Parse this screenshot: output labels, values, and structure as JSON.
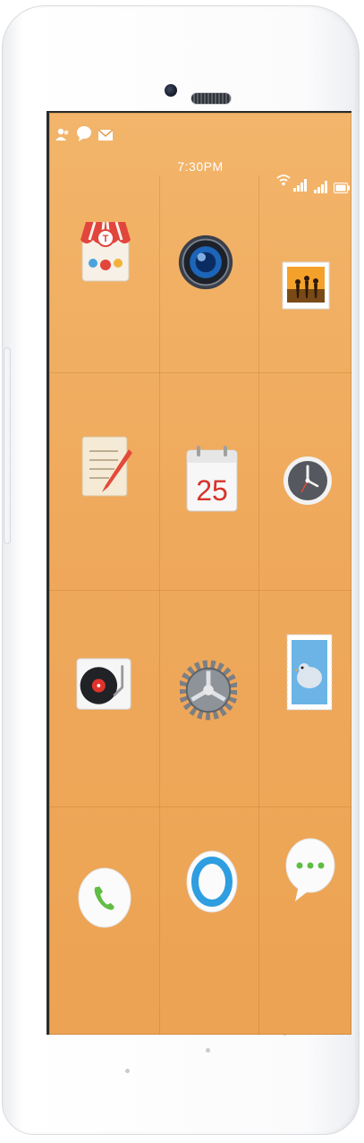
{
  "status_bar": {
    "time": "7:30PM",
    "notification_icons": [
      "contacts-icon",
      "chat-bubble-icon",
      "mail-icon"
    ],
    "system_icons": [
      "wifi-icon",
      "signal-icon",
      "signal-icon",
      "battery-icon"
    ]
  },
  "home_screen": {
    "apps": [
      {
        "icon": "store-icon"
      },
      {
        "icon": "camera-icon"
      },
      {
        "icon": "photos-icon"
      },
      {
        "icon": "notes-icon"
      },
      {
        "icon": "calendar-icon",
        "label": "25"
      },
      {
        "icon": "clock-icon"
      },
      {
        "icon": "music-player-icon"
      },
      {
        "icon": "settings-gear-icon"
      },
      {
        "icon": "stamp-mail-icon"
      }
    ],
    "dock": [
      {
        "icon": "phone-icon"
      },
      {
        "icon": "browser-icon"
      },
      {
        "icon": "messages-icon"
      }
    ]
  },
  "colors": {
    "wallpaper": "#efa95c",
    "phone_body": "#ffffff"
  }
}
